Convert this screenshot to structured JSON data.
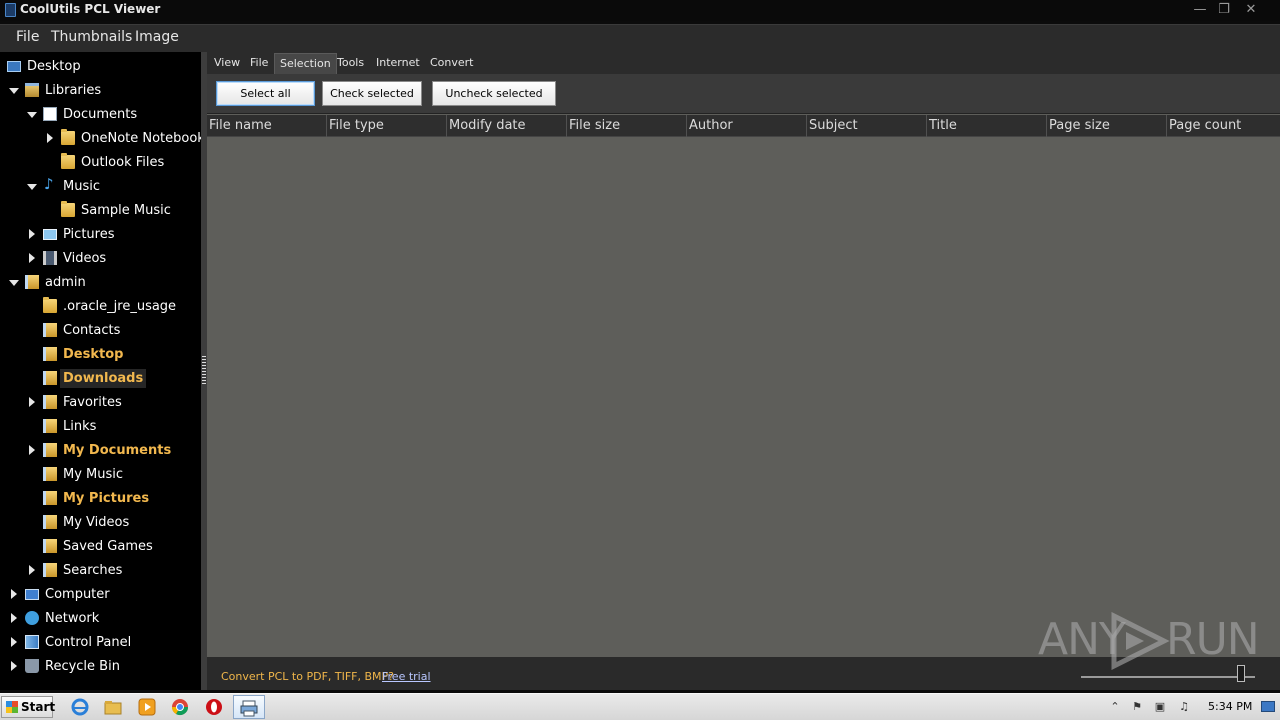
{
  "window": {
    "title": "CoolUtils PCL Viewer",
    "minimize_glyph": "—",
    "restore_glyph": "❐",
    "close_glyph": "✕"
  },
  "menubar": {
    "items": [
      "File",
      "Thumbnails",
      "Image"
    ]
  },
  "tree": {
    "items": [
      {
        "label": "Desktop",
        "icon": "desktop-icon",
        "arrow": "none"
      },
      {
        "label": "Libraries",
        "icon": "library-icon",
        "arrow": "open"
      },
      {
        "label": "Documents",
        "icon": "documents-icon",
        "arrow": "open"
      },
      {
        "label": "OneNote Notebooks",
        "icon": "folder-icon",
        "arrow": "closed"
      },
      {
        "label": "Outlook Files",
        "icon": "folder-icon",
        "arrow": "none"
      },
      {
        "label": "Music",
        "icon": "music-icon",
        "arrow": "open"
      },
      {
        "label": "Sample Music",
        "icon": "folder-icon",
        "arrow": "none"
      },
      {
        "label": "Pictures",
        "icon": "pictures-icon",
        "arrow": "closed"
      },
      {
        "label": "Videos",
        "icon": "videos-icon",
        "arrow": "closed"
      },
      {
        "label": "admin",
        "icon": "user-folder-icon",
        "arrow": "open"
      },
      {
        "label": ".oracle_jre_usage",
        "icon": "folder-icon",
        "arrow": "none"
      },
      {
        "label": "Contacts",
        "icon": "contacts-folder-icon",
        "arrow": "none"
      },
      {
        "label": "Desktop",
        "icon": "desktop-folder-icon",
        "arrow": "none",
        "bold": true
      },
      {
        "label": "Downloads",
        "icon": "downloads-folder-icon",
        "arrow": "none",
        "bold": true,
        "selected": true
      },
      {
        "label": "Favorites",
        "icon": "favorites-folder-icon",
        "arrow": "closed"
      },
      {
        "label": "Links",
        "icon": "links-folder-icon",
        "arrow": "none"
      },
      {
        "label": "My Documents",
        "icon": "documents-folder-icon",
        "arrow": "closed",
        "bold": true
      },
      {
        "label": "My Music",
        "icon": "music-folder-icon",
        "arrow": "none"
      },
      {
        "label": "My Pictures",
        "icon": "pictures-folder-icon",
        "arrow": "none",
        "bold": true
      },
      {
        "label": "My Videos",
        "icon": "videos-folder-icon",
        "arrow": "none"
      },
      {
        "label": "Saved Games",
        "icon": "games-folder-icon",
        "arrow": "none"
      },
      {
        "label": "Searches",
        "icon": "searches-folder-icon",
        "arrow": "closed"
      },
      {
        "label": "Computer",
        "icon": "computer-icon",
        "arrow": "closed"
      },
      {
        "label": "Network",
        "icon": "network-icon",
        "arrow": "closed"
      },
      {
        "label": "Control Panel",
        "icon": "control-panel-icon",
        "arrow": "closed"
      },
      {
        "label": "Recycle Bin",
        "icon": "recycle-bin-icon",
        "arrow": "closed"
      }
    ]
  },
  "tabs": {
    "items": [
      "View",
      "File",
      "Selection",
      "Tools",
      "Internet",
      "Convert"
    ],
    "active": "Selection"
  },
  "toolbar": {
    "select_all": "Select all",
    "check_selected": "Check selected",
    "uncheck_selected": "Uncheck selected"
  },
  "columns": [
    "File name",
    "File type",
    "Modify date",
    "File size",
    "Author",
    "Subject",
    "Title",
    "Page size",
    "Page count"
  ],
  "statusbar": {
    "promo": "Convert PCL to PDF, TIFF, BMP?",
    "trial_link": "Free trial",
    "zoom_level": 0.92
  },
  "watermark": {
    "left": "ANY",
    "right": "RUN"
  },
  "taskbar": {
    "start_label": "Start",
    "pinned": [
      "ie-icon",
      "explorer-icon",
      "media-player-icon",
      "chrome-icon",
      "opera-icon",
      "pcl-viewer-icon"
    ],
    "tray": [
      "show-hidden-icons-icon",
      "action-center-flag-icon",
      "network-tray-icon",
      "volume-icon"
    ],
    "clock": "5:34 PM"
  },
  "colors": {
    "accent_text": "#f2b84e",
    "link": "#b9c7ff",
    "panel_bg": "#5e5e5a"
  }
}
